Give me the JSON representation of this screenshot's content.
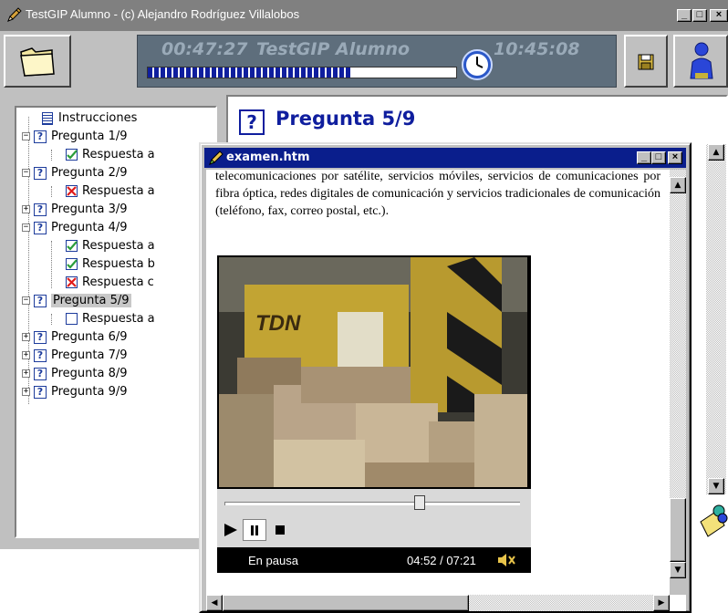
{
  "window": {
    "title": "TestGIP Alumno -  (c) Alejandro Rodríguez Villalobos",
    "min_label": "_",
    "max_label": "□",
    "close_label": "×"
  },
  "timer": {
    "elapsed": "00:47:27",
    "title": "TestGIP Alumno",
    "clock": "10:45:08",
    "progress": 0.66
  },
  "tree": [
    {
      "type": "instructions",
      "label": "Instrucciones",
      "icon": "document-icon"
    },
    {
      "type": "question",
      "label": "Pregunta 1/9",
      "expanded": true
    },
    {
      "type": "answer",
      "label": "Respuesta a",
      "status": "correct"
    },
    {
      "type": "question",
      "label": "Pregunta 2/9",
      "expanded": true
    },
    {
      "type": "answer",
      "label": "Respuesta a",
      "status": "wrong"
    },
    {
      "type": "question",
      "label": "Pregunta 3/9",
      "expanded": false
    },
    {
      "type": "question",
      "label": "Pregunta 4/9",
      "expanded": true
    },
    {
      "type": "answer",
      "label": "Respuesta a",
      "status": "correct"
    },
    {
      "type": "answer",
      "label": "Respuesta b",
      "status": "correct"
    },
    {
      "type": "answer",
      "label": "Respuesta c",
      "status": "wrong"
    },
    {
      "type": "question",
      "label": "Pregunta 5/9",
      "expanded": true,
      "selected": true
    },
    {
      "type": "answer",
      "label": "Respuesta a",
      "status": "empty"
    },
    {
      "type": "question",
      "label": "Pregunta 6/9",
      "expanded": false
    },
    {
      "type": "question",
      "label": "Pregunta 7/9",
      "expanded": false
    },
    {
      "type": "question",
      "label": "Pregunta 8/9",
      "expanded": false
    },
    {
      "type": "question",
      "label": "Pregunta 9/9",
      "expanded": false
    }
  ],
  "question": {
    "title": "Pregunta 5/9",
    "icon_glyph": "?"
  },
  "popup": {
    "title": "examen.htm",
    "body_text": "telecomunicaciones por satélite, servicios móviles, servicios de comunicaciones por fibra óptica, redes digitales de comunicación y servicios tradicionales de comunicación (teléfono, fax, correo postal, etc.).",
    "min_label": "_",
    "max_label": "□",
    "close_label": "×"
  },
  "player": {
    "status": "En pausa",
    "time": "04:52 / 07:21",
    "seek_position": 0.66
  },
  "colors": {
    "accent": "#0f1e9e",
    "popup_title_bar": "#0a1e8c",
    "correct": "#2a9d3a",
    "wrong": "#e01b1b"
  }
}
